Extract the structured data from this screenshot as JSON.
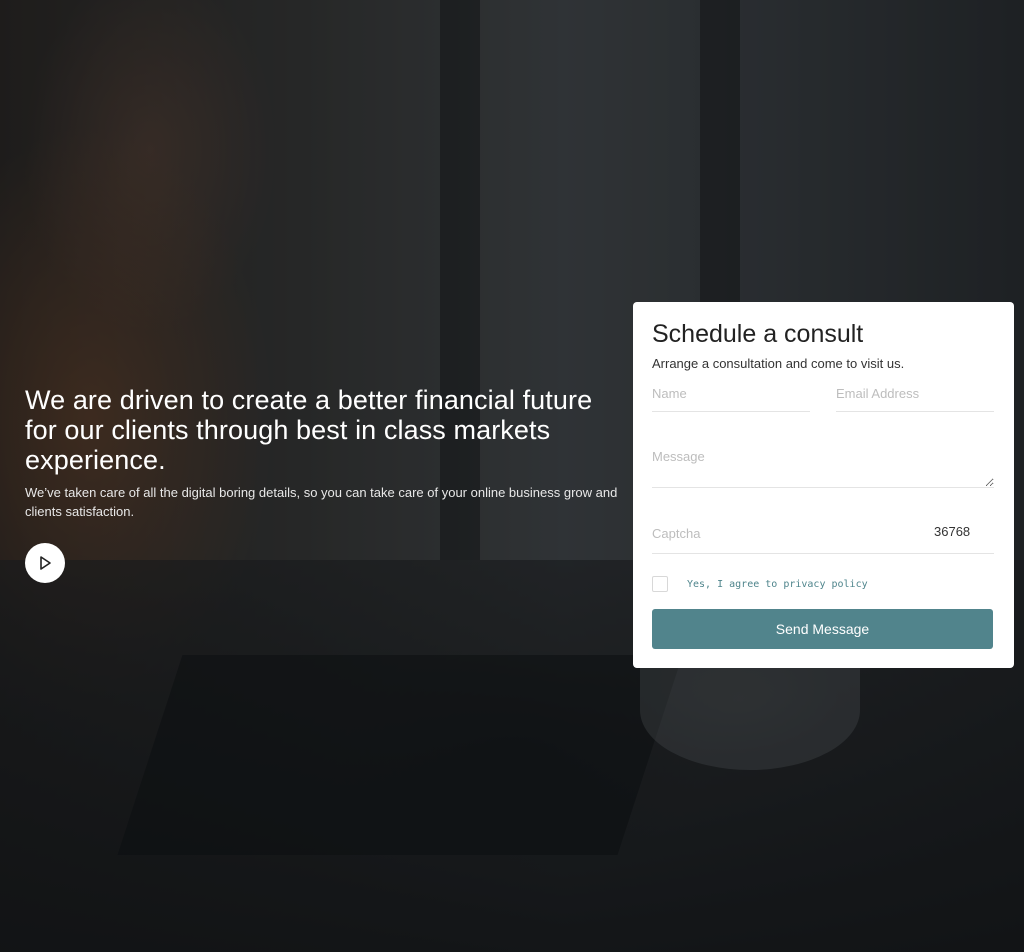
{
  "hero": {
    "heading": "We are driven to create a better financial future for our clients through best in class markets experience.",
    "subheading": "We’ve taken care of all the digital boring details, so you can take care of your online business grow and clients satisfaction.",
    "play_icon": "play-icon"
  },
  "form": {
    "title": "Schedule a consult",
    "subtitle": "Arrange a consultation and come to visit us.",
    "name_placeholder": "Name",
    "email_placeholder": "Email Address",
    "message_placeholder": "Message",
    "captcha_placeholder": "Captcha",
    "captcha_code": "36768",
    "agree_label": "Yes, I agree to privacy policy",
    "submit_label": "Send Message"
  },
  "colors": {
    "accent": "#51848c",
    "agree_text": "#4f858c",
    "card_bg": "#ffffff"
  }
}
